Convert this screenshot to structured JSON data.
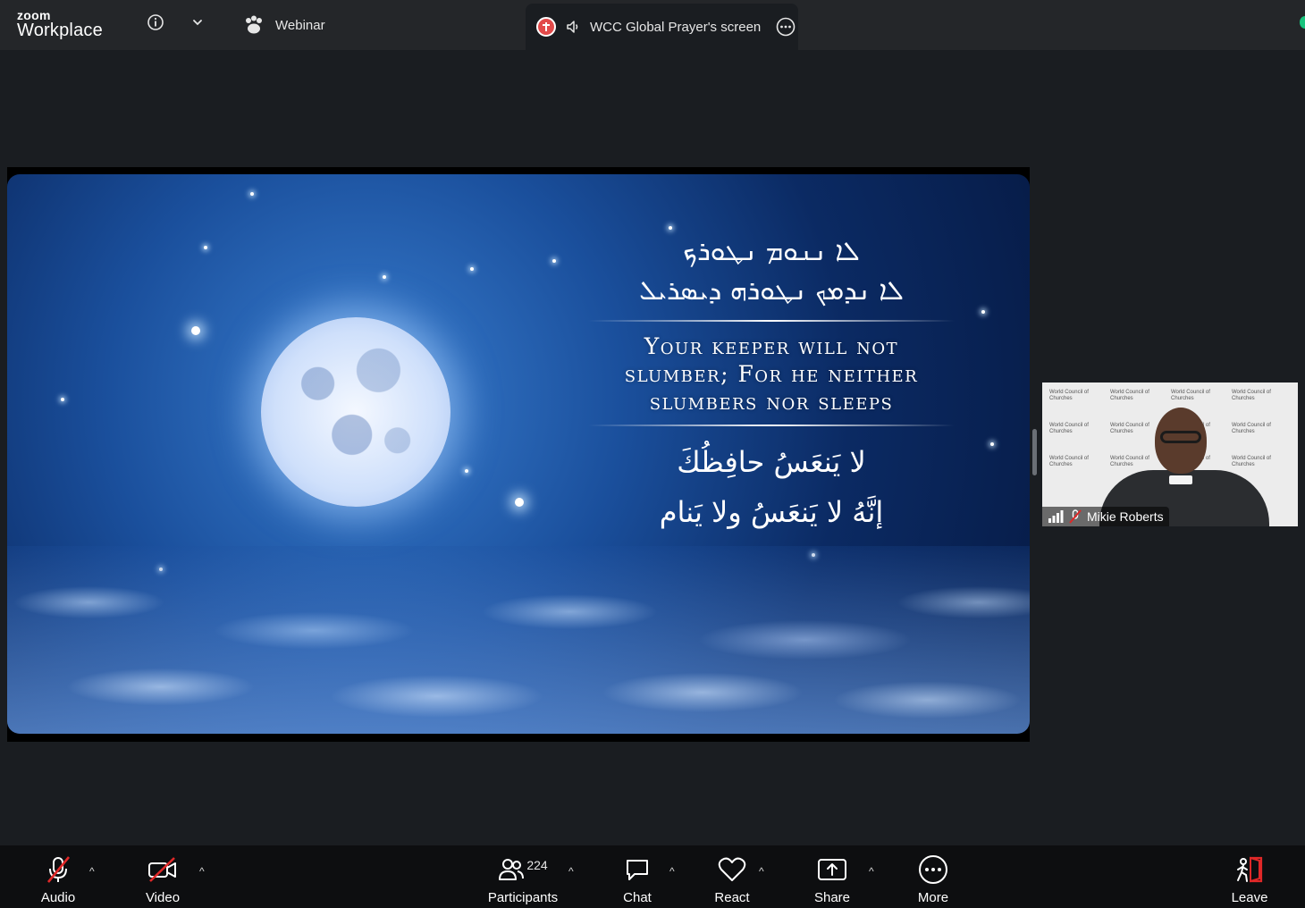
{
  "header": {
    "brand_small": "zoom",
    "brand_big": "Workplace",
    "webinar_label": "Webinar",
    "share_title": "WCC Global Prayer's screen"
  },
  "slide": {
    "syriac_line1": "ܠܐ ܢܢܘܡ ܢܛܘܪܟ",
    "syriac_line2": "ܠܐ ܢܕܡܟ ܢܛܘܪܗ ܕܝܣܪܝܠ",
    "english_line1": "Your keeper will not",
    "english_line2": "slumber; For he neither",
    "english_line3": "slumbers nor sleeps",
    "arabic_line1": "لا يَنعَسُ حافِظُكَ",
    "arabic_line2": "إنَّهُ لا يَنعَسُ ولا يَنام"
  },
  "speaker": {
    "name": "Mikie Roberts",
    "backdrop_text": "World Council of Churches"
  },
  "toolbar": {
    "audio": "Audio",
    "video": "Video",
    "participants": "Participants",
    "participants_count": "224",
    "chat": "Chat",
    "react": "React",
    "share": "Share",
    "more": "More",
    "leave": "Leave"
  },
  "colors": {
    "topbar": "#242629",
    "background": "#1a1d21",
    "toolbar": "#0d0e10",
    "muted_red": "#e02828",
    "leave_red": "#e02828",
    "status_green": "#19c37d"
  },
  "icons": {
    "info": "info-icon",
    "chevron": "chevron-down-icon",
    "webinar": "paw-icon",
    "speaker": "speaker-icon",
    "more_options": "more-options-icon"
  }
}
